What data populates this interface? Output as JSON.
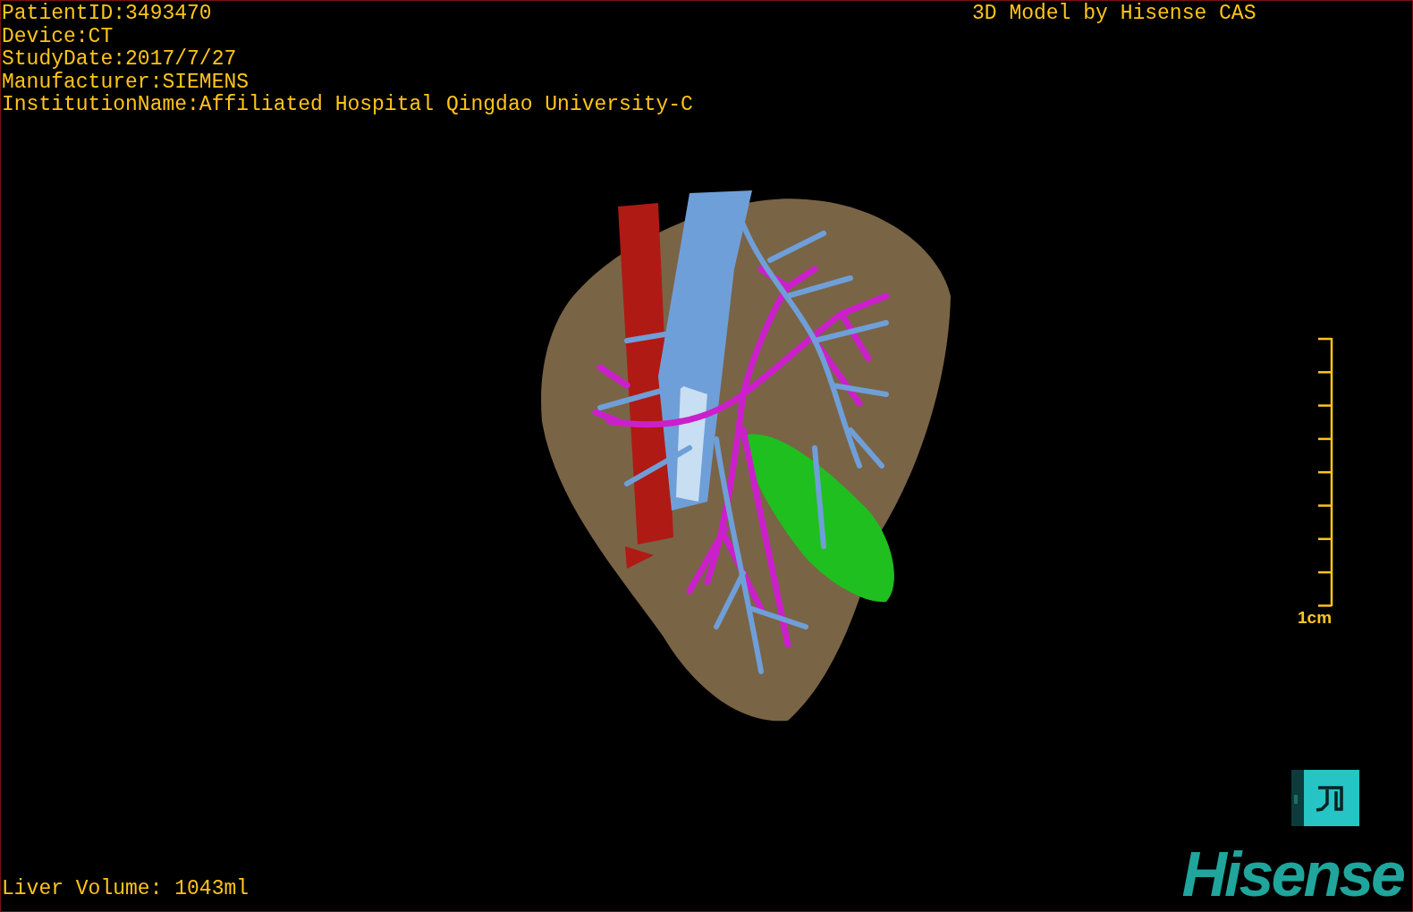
{
  "info_lines": [
    "PatientID:3493470",
    "Device:CT",
    "StudyDate:2017/7/27",
    "Manufacturer:SIEMENS",
    "InstitutionName:Affiliated Hospital Qingdao University-C"
  ],
  "header_title": "3D Model by Hisense CAS",
  "scale_bar": {
    "label": "1cm"
  },
  "liver_volume": "Liver Volume: 1043ml",
  "logo": "Hisense"
}
